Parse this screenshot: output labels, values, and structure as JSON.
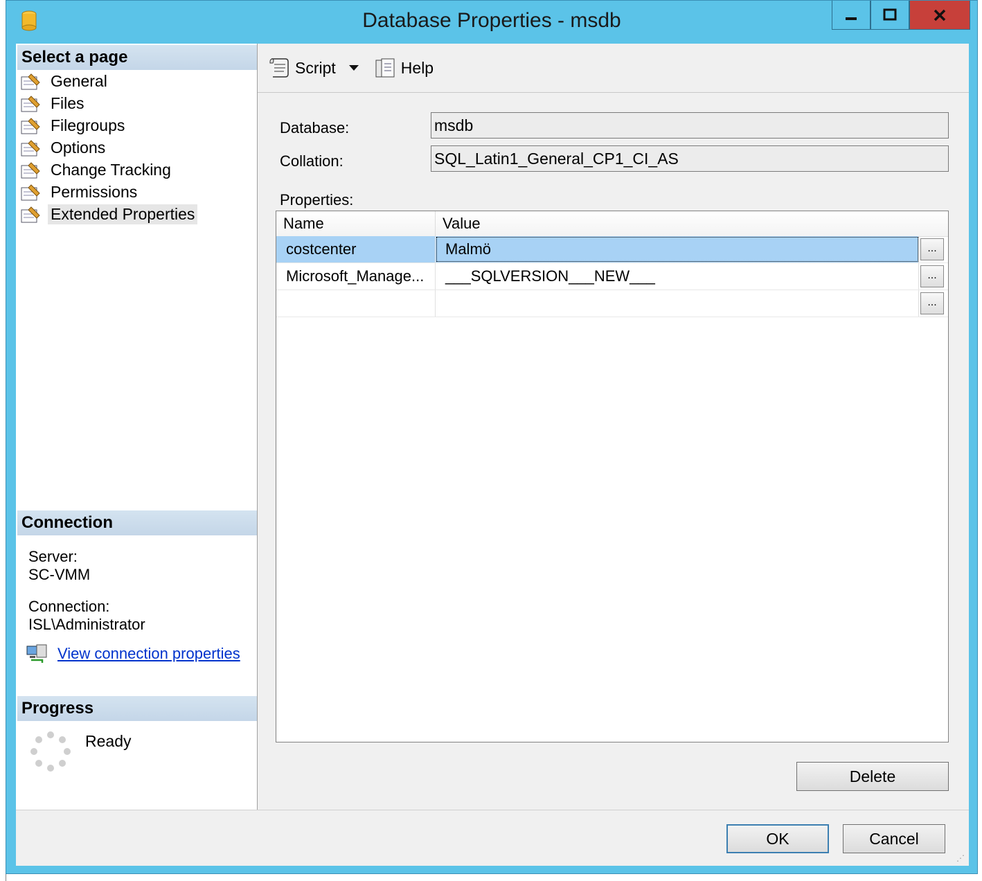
{
  "window": {
    "title": "Database Properties - msdb",
    "minimize_label": "▁",
    "maximize_label": "☐",
    "close_label": "✕"
  },
  "left": {
    "select_page_header": "Select a page",
    "pages": [
      {
        "label": "General"
      },
      {
        "label": "Files"
      },
      {
        "label": "Filegroups"
      },
      {
        "label": "Options"
      },
      {
        "label": "Change Tracking"
      },
      {
        "label": "Permissions"
      },
      {
        "label": "Extended Properties",
        "selected": true
      }
    ],
    "connection_header": "Connection",
    "server_label": "Server:",
    "server_value": "SC-VMM",
    "connection_label": "Connection:",
    "connection_value": "ISL\\Administrator",
    "view_connection_link": "View connection properties",
    "progress_header": "Progress",
    "progress_status": "Ready"
  },
  "toolbar": {
    "script_label": "Script",
    "help_label": "Help"
  },
  "form": {
    "database_label": "Database:",
    "database_value": "msdb",
    "collation_label": "Collation:",
    "collation_value": "SQL_Latin1_General_CP1_CI_AS",
    "properties_label": "Properties:"
  },
  "grid": {
    "columns": [
      "Name",
      "Value"
    ],
    "rows": [
      {
        "name": "costcenter",
        "value": "Malmö",
        "selected": true
      },
      {
        "name": "Microsoft_Manage...",
        "value": "___SQLVERSION___NEW___"
      },
      {
        "name": "",
        "value": ""
      }
    ],
    "ellipsis_label": "..."
  },
  "buttons": {
    "delete": "Delete",
    "ok": "OK",
    "cancel": "Cancel"
  },
  "colors": {
    "titlebar": "#5bc3e8",
    "close_button": "#c7403a",
    "selection": "#a8d2f5",
    "link": "#0033cc"
  }
}
